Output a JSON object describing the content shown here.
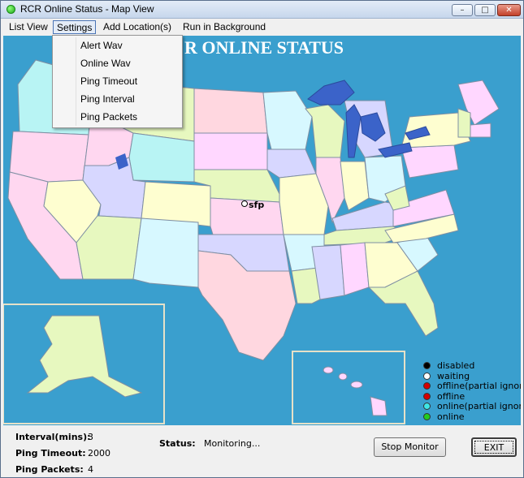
{
  "window": {
    "title": "RCR Online Status - Map View"
  },
  "menubar": {
    "items": [
      "List View",
      "Settings",
      "Add Location(s)",
      "Run in Background"
    ]
  },
  "settings_menu": {
    "items": [
      "Alert Wav",
      "Online Wav",
      "Ping Timeout",
      "Ping Interval",
      "Ping Packets"
    ]
  },
  "map": {
    "title": "R ONLINE STATUS",
    "location": {
      "label": "sfp",
      "status": "waiting"
    }
  },
  "legend": [
    {
      "label": "disabled",
      "color": "#000000"
    },
    {
      "label": "waiting",
      "color": "#ffffff"
    },
    {
      "label": "offline(partial ignore)",
      "color": "#d40000"
    },
    {
      "label": "offline",
      "color": "#d40000"
    },
    {
      "label": "online(partial ignore)",
      "color": "#3ee6e6"
    },
    {
      "label": "online",
      "color": "#22cc22"
    }
  ],
  "status_panel": {
    "interval_label": "Interval(mins):",
    "interval_value": "3",
    "timeout_label": "Ping Timeout:",
    "timeout_value": "2000",
    "packets_label": "Ping Packets:",
    "packets_value": "4",
    "status_label": "Status:",
    "status_value": "Monitoring..."
  },
  "buttons": {
    "stop": "Stop Monitor",
    "exit": "EXIT"
  },
  "colors": {
    "water": "#3a9fce",
    "great_lakes": "#3b63c9",
    "title_green": "#1ea61a"
  }
}
